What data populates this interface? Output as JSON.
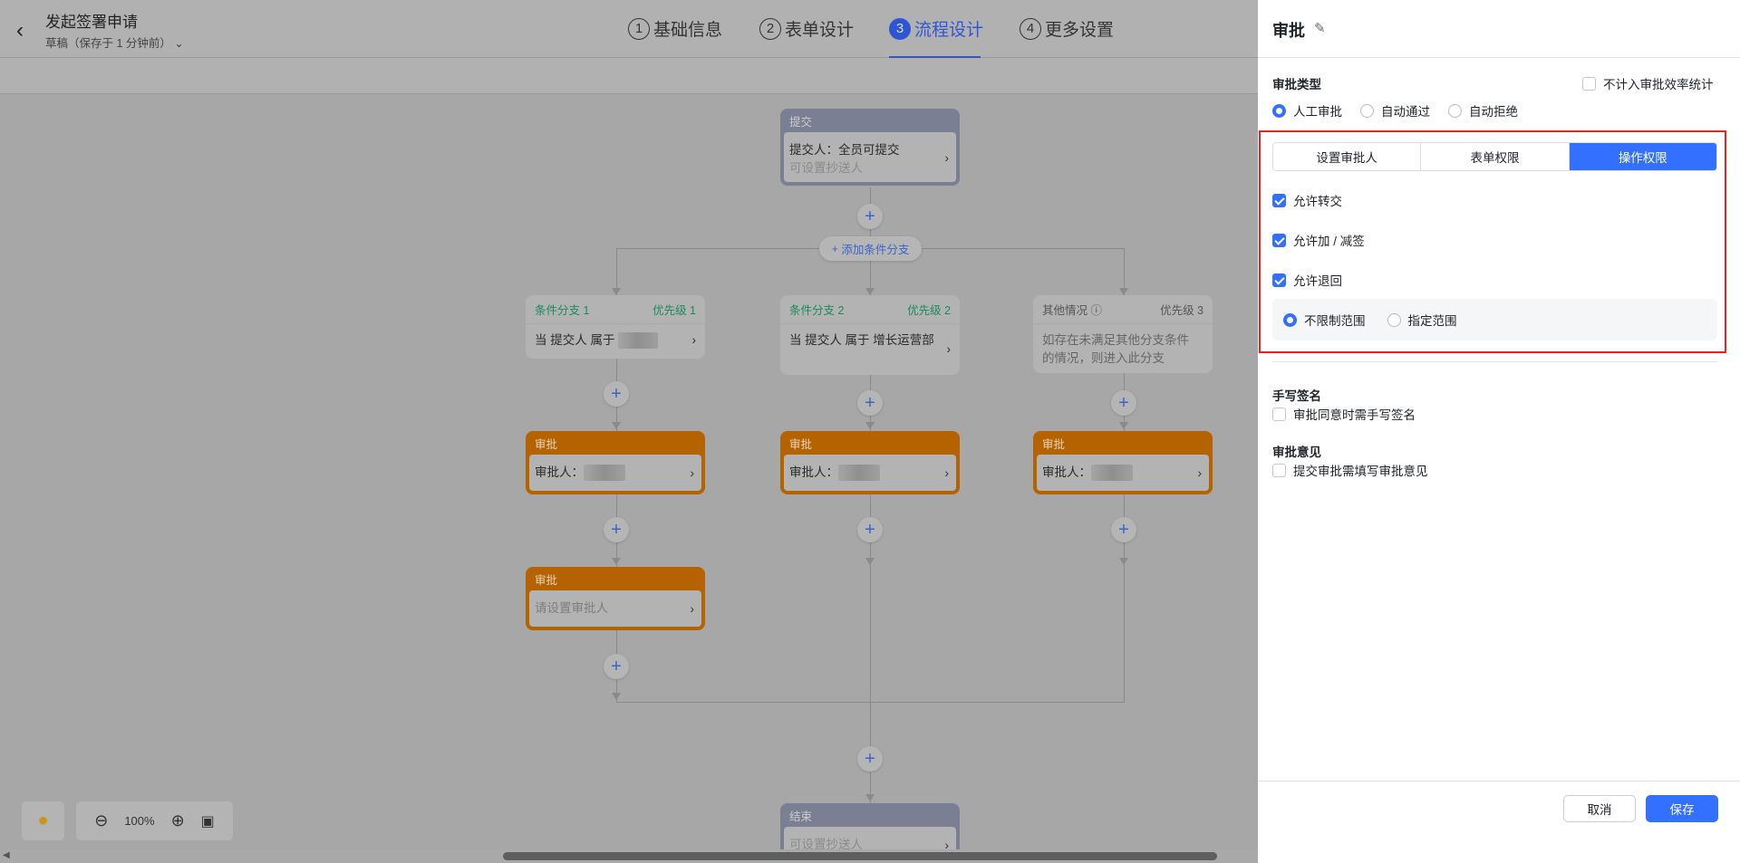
{
  "header": {
    "title": "发起签署申请",
    "draft_status": "草稿（保存于 1 分钟前）",
    "steps": [
      {
        "num": "1",
        "label": "基础信息"
      },
      {
        "num": "2",
        "label": "表单设计"
      },
      {
        "num": "3",
        "label": "流程设计",
        "active": true
      },
      {
        "num": "4",
        "label": "更多设置"
      }
    ]
  },
  "flow": {
    "submit": {
      "title": "提交",
      "line1": "提交人：全员可提交",
      "line2": "可设置抄送人"
    },
    "add_branch": "添加条件分支",
    "branches": [
      {
        "name": "条件分支 1",
        "priority": "优先级 1",
        "condition": "当 提交人 属于"
      },
      {
        "name": "条件分支 2",
        "priority": "优先级 2",
        "condition": "当 提交人 属于 增长运营部"
      },
      {
        "name": "其他情况",
        "priority": "优先级 3",
        "condition": "如存在未满足其他分支条件的情况，则进入此分支"
      }
    ],
    "approve_title": "审批",
    "approver_label": "审批人：",
    "unset_approver": "请设置审批人",
    "end": {
      "title": "结束",
      "line1": "可设置抄送人"
    }
  },
  "canvas_tools": {
    "zoom": "100%"
  },
  "panel": {
    "title": "审批",
    "approve_type_label": "审批类型",
    "exclude_stats": "不计入审批效率统计",
    "approve_types": [
      "人工审批",
      "自动通过",
      "自动拒绝"
    ],
    "tabs": [
      "设置审批人",
      "表单权限",
      "操作权限"
    ],
    "permissions": [
      {
        "label": "允许转交",
        "checked": true
      },
      {
        "label": "允许加 / 减签",
        "checked": true
      },
      {
        "label": "允许退回",
        "checked": true
      }
    ],
    "scope": [
      "不限制范围",
      "指定范围"
    ],
    "signature_label": "手写签名",
    "signature_option": "审批同意时需手写签名",
    "opinion_label": "审批意见",
    "opinion_option": "提交审批需填写审批意见",
    "cancel": "取消",
    "save": "保存"
  },
  "colors": {
    "accent": "#3370ff",
    "approve_node": "#b56200",
    "submit_node": "#7a7f93",
    "condition_text": "#1a8a5c",
    "highlight": "#f0201a"
  }
}
